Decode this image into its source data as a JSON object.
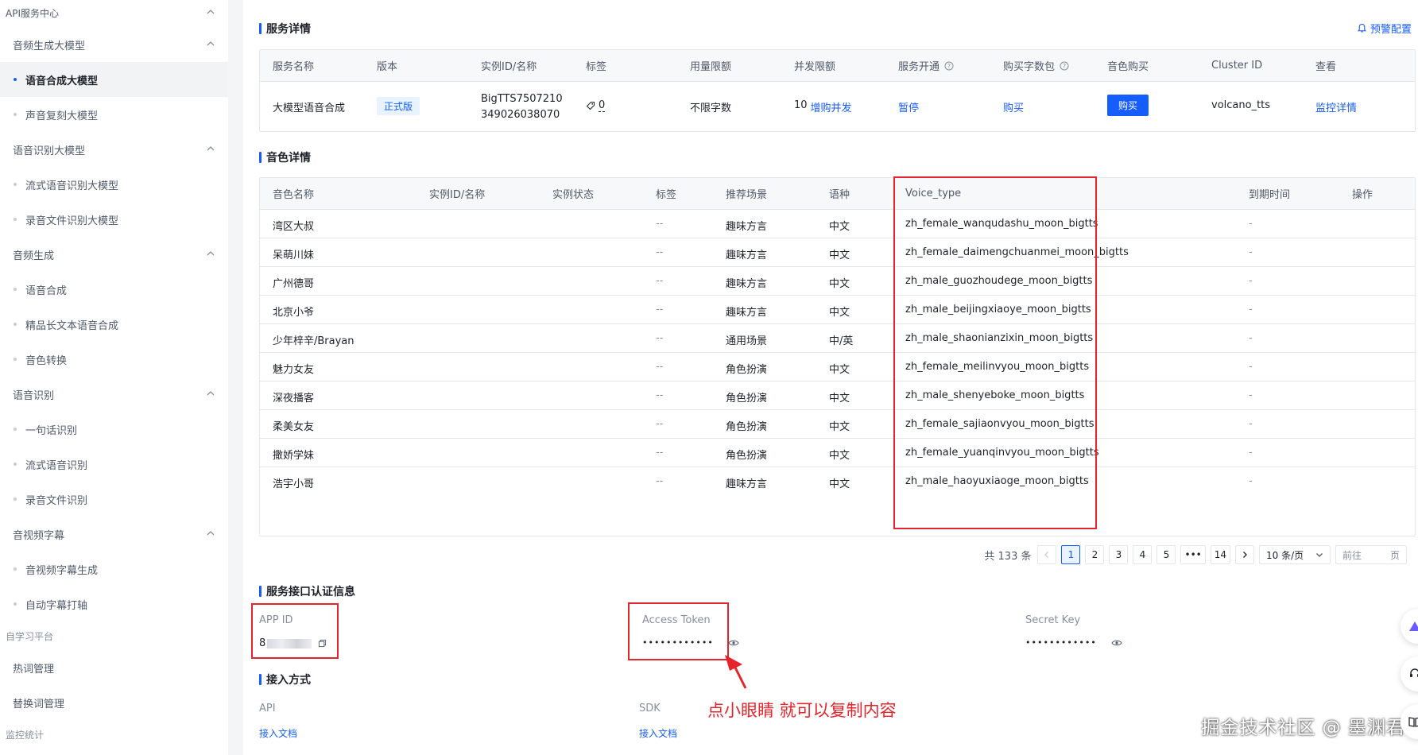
{
  "sidebar": {
    "groups": [
      {
        "label": "API服务中心"
      },
      {
        "label": "自学习平台"
      },
      {
        "label": "监控统计"
      }
    ],
    "sections": [
      {
        "label": "音频生成大模型"
      },
      {
        "label": "语音识别大模型"
      },
      {
        "label": "音频生成"
      },
      {
        "label": "语音识别"
      },
      {
        "label": "音视频字幕"
      },
      {
        "label": "热词管理"
      },
      {
        "label": "替换词管理"
      }
    ],
    "items": [
      {
        "label": "语音合成大模型",
        "active": true
      },
      {
        "label": "声音复刻大模型"
      },
      {
        "label": "流式语音识别大模型"
      },
      {
        "label": "录音文件识别大模型"
      },
      {
        "label": "语音合成"
      },
      {
        "label": "精品长文本语音合成"
      },
      {
        "label": "音色转换"
      },
      {
        "label": "一句话识别"
      },
      {
        "label": "流式语音识别"
      },
      {
        "label": "录音文件识别"
      },
      {
        "label": "音视频字幕生成"
      },
      {
        "label": "自动字幕打轴"
      }
    ]
  },
  "service": {
    "title": "服务详情",
    "alert_config": "预警配置",
    "headers": [
      "服务名称",
      "版本",
      "实例ID/名称",
      "标签",
      "用量限额",
      "并发限额",
      "服务开通",
      "购买字数包",
      "音色购买",
      "Cluster ID",
      "查看"
    ],
    "row": {
      "name": "大模型语音合成",
      "version": "正式版",
      "instance_line1": "BigTTS7507210",
      "instance_line2": "349026038070",
      "tag_count": "0",
      "usage_limit": "不限字数",
      "concurrency": "10",
      "concurrency_link": "增购并发",
      "open_link": "暂停",
      "buy_pack_link": "购买",
      "buy_voice_btn": "购买",
      "cluster_id": "volcano_tts",
      "view_link": "监控详情"
    }
  },
  "voices": {
    "title": "音色详情",
    "headers": [
      "音色名称",
      "实例ID/名称",
      "实例状态",
      "标签",
      "推荐场景",
      "语种",
      "Voice_type",
      "到期时间",
      "操作"
    ],
    "rows": [
      {
        "name": "湾区大叔",
        "tag": "--",
        "scene": "趣味方言",
        "lang": "中文",
        "voice_type": "zh_female_wanqudashu_moon_bigtts",
        "expire": "-"
      },
      {
        "name": "呆萌川妹",
        "tag": "--",
        "scene": "趣味方言",
        "lang": "中文",
        "voice_type": "zh_female_daimengchuanmei_moon_bigtts",
        "expire": "-"
      },
      {
        "name": "广州德哥",
        "tag": "--",
        "scene": "趣味方言",
        "lang": "中文",
        "voice_type": "zh_male_guozhoudege_moon_bigtts",
        "expire": "-"
      },
      {
        "name": "北京小爷",
        "tag": "--",
        "scene": "趣味方言",
        "lang": "中文",
        "voice_type": "zh_male_beijingxiaoye_moon_bigtts",
        "expire": "-"
      },
      {
        "name": "少年梓辛/Brayan",
        "tag": "--",
        "scene": "通用场景",
        "lang": "中/英",
        "voice_type": "zh_male_shaonianzixin_moon_bigtts",
        "expire": "-"
      },
      {
        "name": "魅力女友",
        "tag": "--",
        "scene": "角色扮演",
        "lang": "中文",
        "voice_type": "zh_female_meilinvyou_moon_bigtts",
        "expire": "-"
      },
      {
        "name": "深夜播客",
        "tag": "--",
        "scene": "角色扮演",
        "lang": "中文",
        "voice_type": "zh_male_shenyeboke_moon_bigtts",
        "expire": "-"
      },
      {
        "name": "柔美女友",
        "tag": "--",
        "scene": "角色扮演",
        "lang": "中文",
        "voice_type": "zh_female_sajiaonvyou_moon_bigtts",
        "expire": "-"
      },
      {
        "name": "撒娇学妹",
        "tag": "--",
        "scene": "角色扮演",
        "lang": "中文",
        "voice_type": "zh_female_yuanqinvyou_moon_bigtts",
        "expire": "-"
      },
      {
        "name": "浩宇小哥",
        "tag": "--",
        "scene": "趣味方言",
        "lang": "中文",
        "voice_type": "zh_male_haoyuxiaoge_moon_bigtts",
        "expire": "-"
      }
    ]
  },
  "pagination": {
    "total": "共 133 条",
    "pages": [
      "1",
      "2",
      "3",
      "4",
      "5",
      "•••",
      "14"
    ],
    "current": "1",
    "page_size": "10 条/页",
    "goto_label": "前往",
    "goto_suffix": "页"
  },
  "auth": {
    "title": "服务接口认证信息",
    "app_id_label": "APP ID",
    "app_id_value": "8",
    "token_label": "Access Token",
    "token_value": "••••••••••••",
    "secret_label": "Secret Key",
    "secret_value": "••••••••••••"
  },
  "access": {
    "title": "接入方式",
    "api_label": "API",
    "api_link": "接入文档",
    "sdk_label": "SDK",
    "sdk_link": "接入文档"
  },
  "annotation": "点小眼睛 就可以复制内容",
  "watermark": "掘金技术社区 @ 墨渊君",
  "colors": {
    "primary": "#165dff",
    "annotation": "#e5242b"
  },
  "icons": [
    "chevron-up-icon",
    "bell-icon",
    "tag-icon",
    "question-circle-icon",
    "copy-icon",
    "eye-icon",
    "chevron-left-icon",
    "chevron-right-icon",
    "chevron-down-icon"
  ]
}
